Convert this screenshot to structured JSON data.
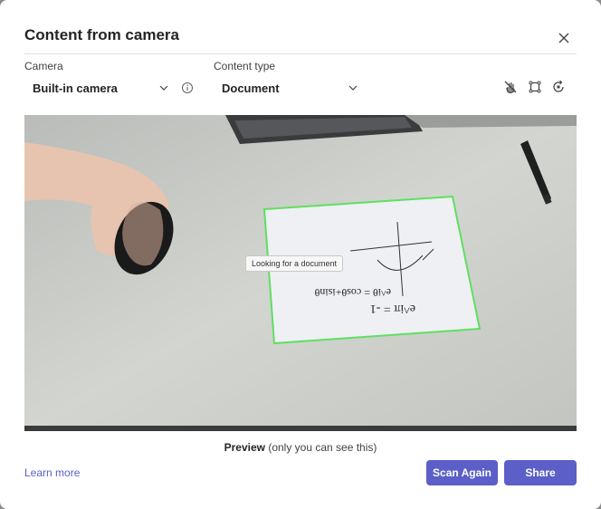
{
  "dialog": {
    "title": "Content from camera",
    "close_icon": "close-icon"
  },
  "camera": {
    "label": "Camera",
    "value": "Built-in camera"
  },
  "content_type": {
    "label": "Content type",
    "value": "Document"
  },
  "toolbar": {
    "icons": [
      "hand-off-icon",
      "crop-icon",
      "rotate-icon"
    ]
  },
  "preview": {
    "status_tooltip": "Looking for a document",
    "caption_bold": "Preview",
    "caption_rest": "(only you can see this)"
  },
  "footer": {
    "learn_more": "Learn more",
    "scan_again": "Scan Again",
    "share": "Share"
  },
  "colors": {
    "accent": "#5b5fc7",
    "detection_outline": "#5fe05f"
  }
}
